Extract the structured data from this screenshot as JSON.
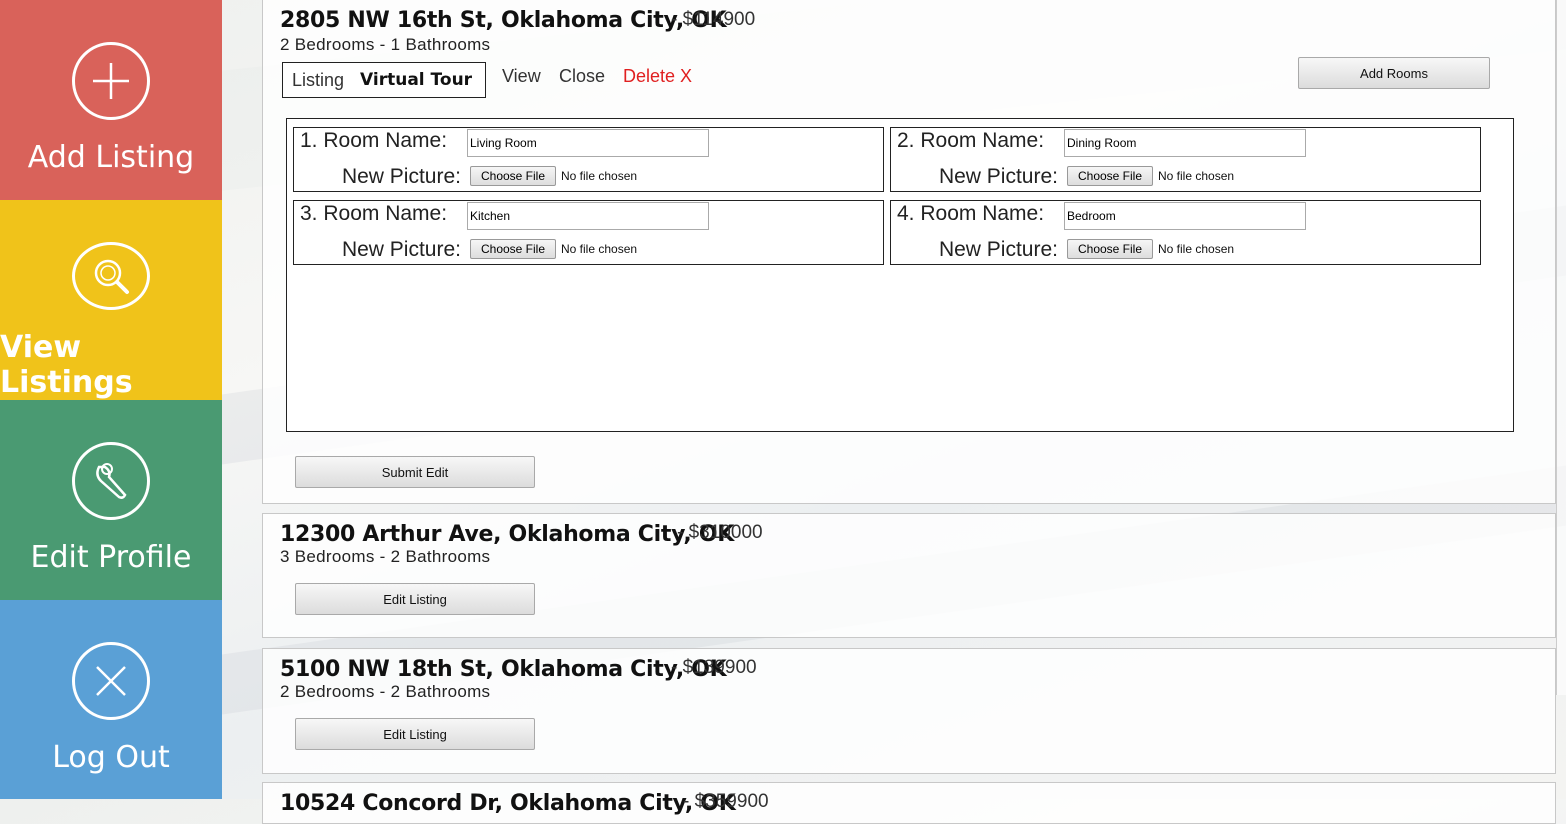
{
  "sidebar": {
    "items": [
      {
        "label": "Add Listing",
        "icon": "plus-icon",
        "color": "#d9625a"
      },
      {
        "label": "View Listings",
        "icon": "search-icon",
        "color": "#f0c31a"
      },
      {
        "label": "Edit Profile",
        "icon": "wrench-icon",
        "color": "#4a9a72"
      },
      {
        "label": "Log Out",
        "icon": "close-icon",
        "color": "#5aa0d6"
      }
    ]
  },
  "listings": [
    {
      "address": "2805 NW 16th St, Oklahoma City, OK",
      "price": "- $114900",
      "beds": "2 Bedrooms - 1 Bathrooms",
      "tabs": [
        "Listing",
        "Virtual Tour"
      ],
      "actions": {
        "view": "View",
        "close": "Close",
        "delete": "Delete X"
      },
      "add_rooms_label": "Add Rooms",
      "rooms": [
        {
          "title": "1. Room Name:",
          "picture_label": "New Picture:",
          "value": "Living Room"
        },
        {
          "title": "2. Room Name:",
          "picture_label": "New Picture:",
          "value": "Dining Room"
        },
        {
          "title": "3. Room Name:",
          "picture_label": "New Picture:",
          "value": "Kitchen"
        },
        {
          "title": "4. Room Name:",
          "picture_label": "New Picture:",
          "value": "Bedroom"
        }
      ],
      "file_button_label": "Choose File",
      "file_status": "No file chosen",
      "submit_label": "Submit Edit"
    },
    {
      "address": "12300 Arthur Ave, Oklahoma City, OK",
      "price": "- $310000",
      "beds": "3 Bedrooms - 2 Bathrooms",
      "edit_label": "Edit Listing"
    },
    {
      "address": "5100 NW 18th St, Oklahoma City, OK",
      "price": "- $139900",
      "beds": "2 Bedrooms - 2 Bathrooms",
      "edit_label": "Edit Listing"
    },
    {
      "address": "10524 Concord Dr, Oklahoma City, OK",
      "price": "- $359900"
    }
  ]
}
